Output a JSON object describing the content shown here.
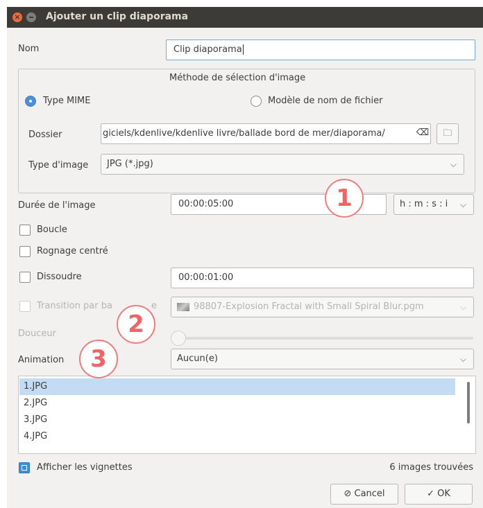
{
  "window": {
    "title": "Ajouter un clip diaporama",
    "close_glyph": "×"
  },
  "name": {
    "label": "Nom",
    "value": "Clip diaporama"
  },
  "selection_group": {
    "title": "Méthode de sélection d'image",
    "radio_mime": "Type MIME",
    "radio_pattern": "Modèle de nom de fichier",
    "folder_label": "Dossier",
    "folder_value": "giciels/kdenlive/kdenlive livre/ballade bord de mer/diaporama/",
    "clear_glyph": "⌫",
    "browse_glyph": "🗀",
    "image_type_label": "Type d'image",
    "image_type_value": "JPG (*.jpg)"
  },
  "duration": {
    "label": "Durée de l'image",
    "value": "00:00:05:00",
    "format": "h : m : s : i"
  },
  "loop": {
    "label": "Boucle"
  },
  "center_crop": {
    "label": "Rognage centré"
  },
  "dissolve": {
    "label": "Dissoudre",
    "value": "00:00:01:00"
  },
  "wipe": {
    "label": "Transition par balayage",
    "visible_label": "Transition par ba",
    "tail": "e",
    "value": "98807-Explosion Fractal with Small Spiral Blur.pgm"
  },
  "softness": {
    "label": "Douceur"
  },
  "animation": {
    "label": "Animation",
    "value": "Aucun(e)"
  },
  "files": [
    "1.JPG",
    "2.JPG",
    "3.JPG",
    "4.JPG"
  ],
  "thumbnails": {
    "label": "Afficher les vignettes"
  },
  "found": "6 images trouvées",
  "buttons": {
    "cancel": "Cancel",
    "cancel_glyph": "⊘",
    "ok": "OK",
    "ok_glyph": "✓"
  },
  "callouts": [
    "1",
    "2",
    "3"
  ],
  "chevron": "⌵",
  "colors": {
    "accent": "#4a90d9",
    "titlebar": "#3c3b37",
    "callout": "#ee6565",
    "selection": "#c3dcf3"
  }
}
